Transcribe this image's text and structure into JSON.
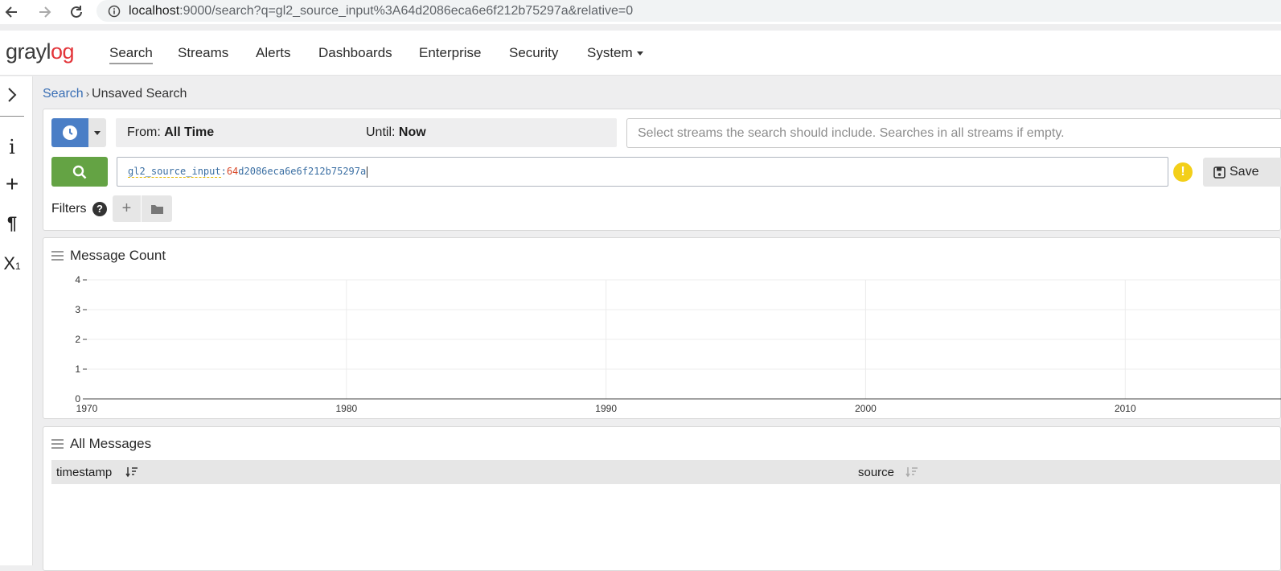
{
  "browser": {
    "url_host": "localhost",
    "url_rest": ":9000/search?q=gl2_source_input%3A64d2086eca6e6f212b75297a&relative=0"
  },
  "logo": {
    "part1": "grayl",
    "part2": "og"
  },
  "nav": {
    "items": [
      "Search",
      "Streams",
      "Alerts",
      "Dashboards",
      "Enterprise",
      "Security",
      "System"
    ]
  },
  "sidebar": {
    "icons": [
      "chevron-right-icon",
      "info-icon",
      "plus-icon",
      "paragraph-icon",
      "subscript-icon"
    ]
  },
  "breadcrumb": {
    "link": "Search",
    "separator": "›",
    "current": "Unsaved Search"
  },
  "timerange": {
    "from_label": "From:",
    "from_value": "All Time",
    "until_label": "Until:",
    "until_value": "Now"
  },
  "streams": {
    "placeholder": "Select streams the search should include. Searches in all streams if empty."
  },
  "query": {
    "field": "gl2_source_input",
    "colon": ":",
    "value_numeric": "64",
    "value_rest": "d2086eca6e6f212b75297a"
  },
  "save": {
    "label": "Save"
  },
  "filters": {
    "label": "Filters",
    "help": "?"
  },
  "widgets": {
    "message_count_title": "Message Count",
    "all_messages_title": "All Messages",
    "columns": [
      "timestamp",
      "source"
    ]
  },
  "colors": {
    "accent_blue": "#4a7ec6",
    "search_green": "#64a344",
    "brand_red": "#e3353a",
    "warning_yellow": "#f3cf19"
  },
  "chart_data": {
    "type": "bar",
    "title": "Message Count",
    "xlabel": "",
    "ylabel": "",
    "x_ticks": [
      1970,
      1980,
      1990,
      2000,
      2010
    ],
    "y_ticks": [
      0,
      1,
      2,
      3,
      4
    ],
    "xlim": [
      1970,
      2016
    ],
    "ylim": [
      0,
      4
    ],
    "series": [],
    "grid": true
  }
}
